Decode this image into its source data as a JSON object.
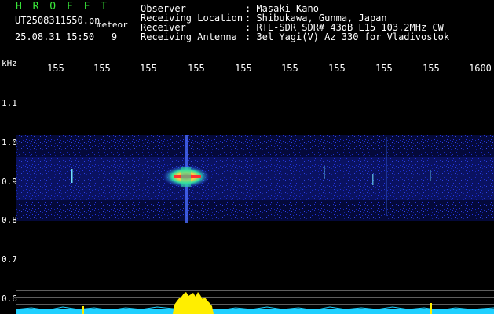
{
  "header": {
    "brand": "H R O F F T",
    "file_name": "UT2508311550.pn",
    "file_suffix": "meteor",
    "timestamp": "25.08.31 15:50   9_",
    "info": [
      {
        "label": "Observer",
        "value": ": Masaki Kano"
      },
      {
        "label": "Receiving Location",
        "value": ": Shibukawa, Gunma, Japan"
      },
      {
        "label": "Receiver",
        "value": ": RTL-SDR SDR# 43dB L15 103.2MHz CW"
      },
      {
        "label": "Receiving Antenna",
        "value": ": 3el Yagi(V) Az 330 for Vladivostok"
      }
    ]
  },
  "axes": {
    "y_unit": "kHz",
    "x_ticks": [
      "155",
      "155",
      "155",
      "155",
      "155",
      "155",
      "155",
      "155",
      "155",
      "1600"
    ],
    "y_ticks": [
      "1.1",
      "1.0",
      "0.9",
      "0.8",
      "0.7",
      "0.6"
    ]
  },
  "colors": {
    "background": "#000000",
    "brand": "#39e639",
    "noise": "#1a2fd8",
    "echo_core": "#ff3030",
    "echo_mid": "#30e0a0",
    "spectrum_fill": "#ffee00",
    "spectrum_base": "#20d0ff"
  }
}
